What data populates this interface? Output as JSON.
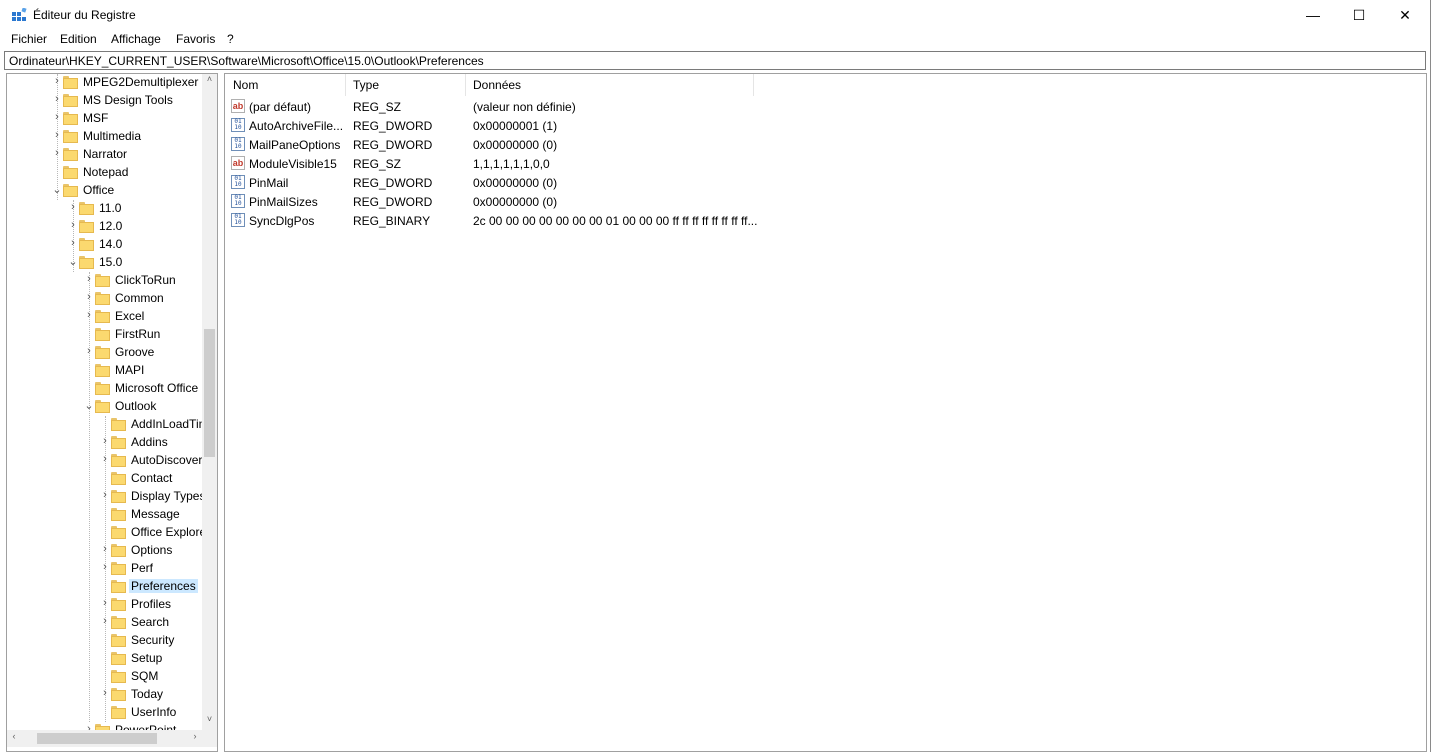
{
  "window": {
    "title": "Éditeur du Registre"
  },
  "window_controls": {
    "minimize": "—",
    "maximize": "☐",
    "close": "✕"
  },
  "menu": [
    "Fichier",
    "Edition",
    "Affichage",
    "Favoris",
    "?"
  ],
  "address": "Ordinateur\\HKEY_CURRENT_USER\\Software\\Microsoft\\Office\\15.0\\Outlook\\Preferences",
  "tree": [
    {
      "label": "MPEG2Demultiplexer",
      "level": 0,
      "chevron": "›"
    },
    {
      "label": "MS Design Tools",
      "level": 0,
      "chevron": "›"
    },
    {
      "label": "MSF",
      "level": 0,
      "chevron": "›"
    },
    {
      "label": "Multimedia",
      "level": 0,
      "chevron": "›"
    },
    {
      "label": "Narrator",
      "level": 0,
      "chevron": "›"
    },
    {
      "label": "Notepad",
      "level": 0,
      "chevron": ""
    },
    {
      "label": "Office",
      "level": 0,
      "chevron": "⌄"
    },
    {
      "label": "11.0",
      "level": 1,
      "chevron": "›"
    },
    {
      "label": "12.0",
      "level": 1,
      "chevron": "›"
    },
    {
      "label": "14.0",
      "level": 1,
      "chevron": "›"
    },
    {
      "label": "15.0",
      "level": 1,
      "chevron": "⌄"
    },
    {
      "label": "ClickToRun",
      "level": 2,
      "chevron": "›"
    },
    {
      "label": "Common",
      "level": 2,
      "chevron": "›"
    },
    {
      "label": "Excel",
      "level": 2,
      "chevron": "›"
    },
    {
      "label": "FirstRun",
      "level": 2,
      "chevron": ""
    },
    {
      "label": "Groove",
      "level": 2,
      "chevron": "›"
    },
    {
      "label": "MAPI",
      "level": 2,
      "chevron": ""
    },
    {
      "label": "Microsoft Office",
      "level": 2,
      "chevron": ""
    },
    {
      "label": "Outlook",
      "level": 2,
      "chevron": "⌄"
    },
    {
      "label": "AddInLoadTin",
      "level": 3,
      "chevron": ""
    },
    {
      "label": "Addins",
      "level": 3,
      "chevron": "›"
    },
    {
      "label": "AutoDiscover",
      "level": 3,
      "chevron": "›"
    },
    {
      "label": "Contact",
      "level": 3,
      "chevron": ""
    },
    {
      "label": "Display Types",
      "level": 3,
      "chevron": "›"
    },
    {
      "label": "Message",
      "level": 3,
      "chevron": ""
    },
    {
      "label": "Office Explore",
      "level": 3,
      "chevron": ""
    },
    {
      "label": "Options",
      "level": 3,
      "chevron": "›"
    },
    {
      "label": "Perf",
      "level": 3,
      "chevron": "›"
    },
    {
      "label": "Preferences",
      "level": 3,
      "chevron": "",
      "selected": true
    },
    {
      "label": "Profiles",
      "level": 3,
      "chevron": "›"
    },
    {
      "label": "Search",
      "level": 3,
      "chevron": "›"
    },
    {
      "label": "Security",
      "level": 3,
      "chevron": ""
    },
    {
      "label": "Setup",
      "level": 3,
      "chevron": ""
    },
    {
      "label": "SQM",
      "level": 3,
      "chevron": ""
    },
    {
      "label": "Today",
      "level": 3,
      "chevron": "›"
    },
    {
      "label": "UserInfo",
      "level": 3,
      "chevron": ""
    },
    {
      "label": "PowerPoint",
      "level": 2,
      "chevron": "›"
    }
  ],
  "tree_scroll": {
    "up": "˄",
    "down": "˅",
    "left": "‹",
    "right": "›"
  },
  "columns": {
    "name": "Nom",
    "type": "Type",
    "data": "Données"
  },
  "values": [
    {
      "icon": "string-value-icon",
      "name": "(par défaut)",
      "type": "REG_SZ",
      "data": "(valeur non définie)"
    },
    {
      "icon": "binary-value-icon",
      "name": "AutoArchiveFile...",
      "type": "REG_DWORD",
      "data": "0x00000001 (1)"
    },
    {
      "icon": "binary-value-icon",
      "name": "MailPaneOptions",
      "type": "REG_DWORD",
      "data": "0x00000000 (0)"
    },
    {
      "icon": "string-value-icon",
      "name": "ModuleVisible15",
      "type": "REG_SZ",
      "data": "1,1,1,1,1,1,0,0"
    },
    {
      "icon": "binary-value-icon",
      "name": "PinMail",
      "type": "REG_DWORD",
      "data": "0x00000000 (0)"
    },
    {
      "icon": "binary-value-icon",
      "name": "PinMailSizes",
      "type": "REG_DWORD",
      "data": "0x00000000 (0)"
    },
    {
      "icon": "binary-value-icon",
      "name": "SyncDlgPos",
      "type": "REG_BINARY",
      "data": "2c 00 00 00 00 00 00 00 01 00 00 00 ff ff ff ff ff ff ff ff..."
    }
  ],
  "icon_glyphs": {
    "string": "ab",
    "binary": "01\n10"
  },
  "colors": {
    "selection": "#cce8ff",
    "folder": "#fbd96f",
    "accent": "#1a73c8"
  }
}
